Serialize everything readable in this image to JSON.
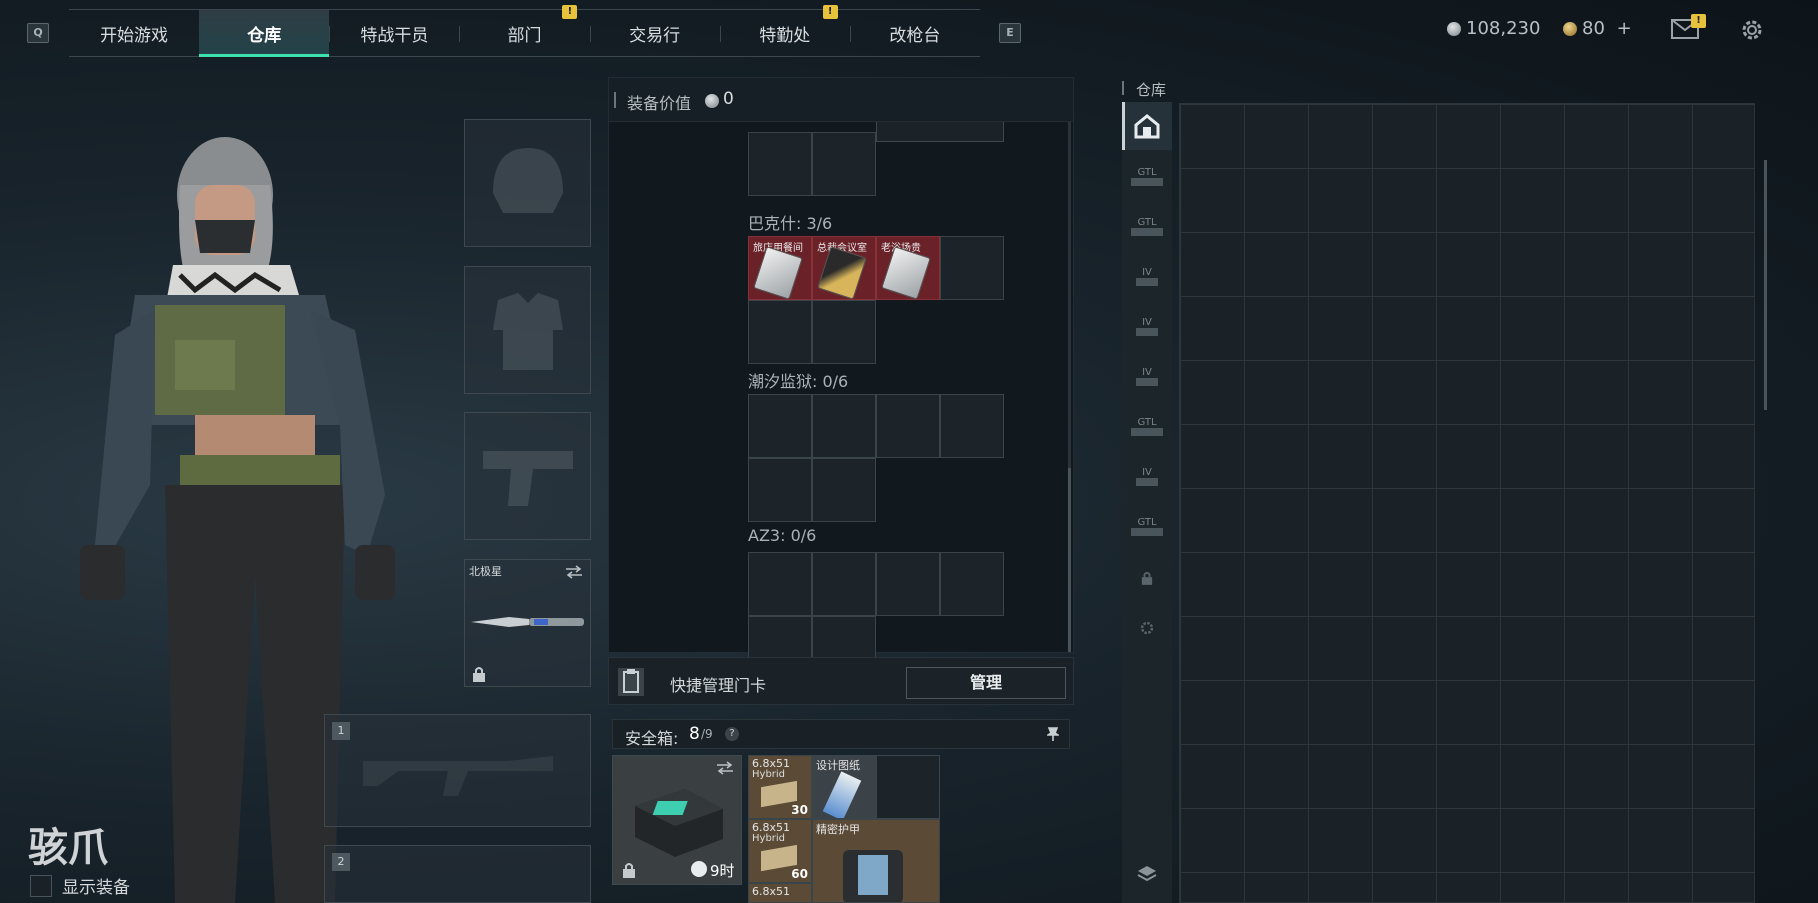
{
  "nav": {
    "left_key": "Q",
    "right_key": "E",
    "tabs": [
      {
        "label": "开始游戏",
        "alert": false
      },
      {
        "label": "仓库",
        "alert": false,
        "active": true
      },
      {
        "label": "特战干员",
        "alert": false
      },
      {
        "label": "部门",
        "alert": true
      },
      {
        "label": "交易行",
        "alert": false
      },
      {
        "label": "特勤处",
        "alert": true
      },
      {
        "label": "改枪台",
        "alert": false
      }
    ],
    "alert_mark": "!"
  },
  "currency": {
    "silver": "108,230",
    "gold": "80",
    "add": "+",
    "mail_alert": "!"
  },
  "character": {
    "name": "骇爪",
    "show_gear_label": "显示装备"
  },
  "equipment": {
    "melee_name": "北极星",
    "weapon_slot_1": "1",
    "weapon_slot_2": "2"
  },
  "keycard_panel": {
    "header_label": "装备价值",
    "header_value": "0",
    "sections": [
      {
        "label": "巴克什: 3/6",
        "cards": [
          "旅店用餐间",
          "总裁会议室",
          "老浴场贵"
        ]
      },
      {
        "label": "潮汐监狱: 0/6",
        "cards": []
      },
      {
        "label": "AZ3: 0/6",
        "cards": []
      }
    ],
    "quick_manage_label": "快捷管理门卡",
    "manage_button": "管理"
  },
  "safe_box": {
    "label": "安全箱:",
    "count": "8",
    "capacity": "/9",
    "help": "?",
    "timer": "9时",
    "items": [
      {
        "label": "6.8x51",
        "sub": "Hybrid",
        "qty": "30"
      },
      {
        "label": "设计图纸",
        "qty": ""
      },
      {
        "label": "6.8x51",
        "sub": "Hybrid",
        "qty": "60"
      },
      {
        "label": "精密护甲",
        "qty": ""
      },
      {
        "label": "6.8x51",
        "qty": ""
      }
    ]
  },
  "stash": {
    "title": "仓库",
    "side_tabs": [
      "GTL",
      "GTL",
      "IV",
      "IV",
      "IV",
      "GTL",
      "IV",
      "GTL"
    ]
  },
  "colors": {
    "accent": "#3fe0b0",
    "alert": "#e8c23a",
    "keycard_bg": "#6a2228"
  }
}
